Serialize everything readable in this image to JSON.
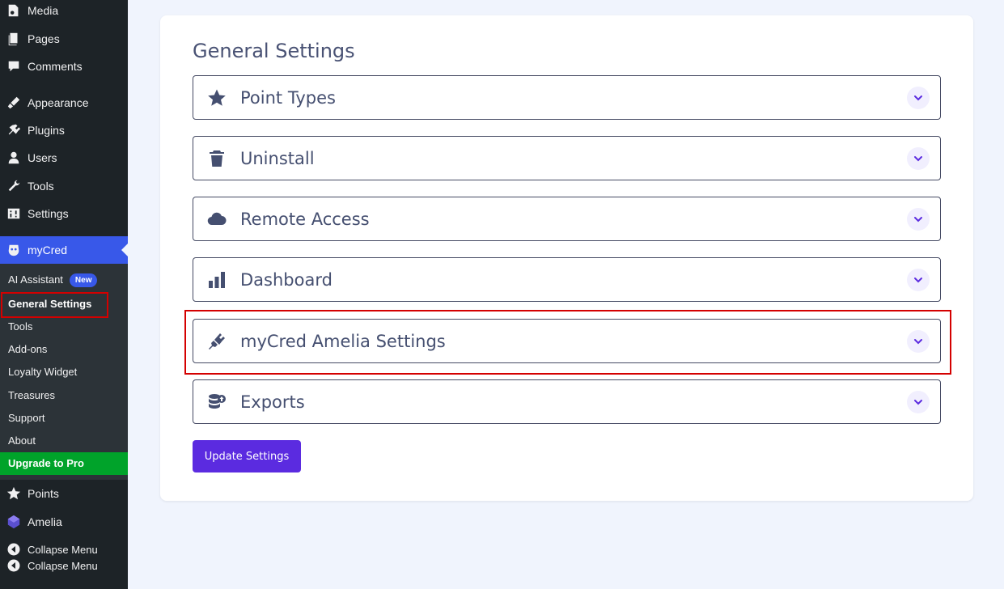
{
  "sidebar": {
    "menu": [
      {
        "label": "Media",
        "icon": "media-icon"
      },
      {
        "label": "Pages",
        "icon": "pages-icon"
      },
      {
        "label": "Comments",
        "icon": "comments-icon"
      },
      {
        "label": "Appearance",
        "icon": "appearance-icon"
      },
      {
        "label": "Plugins",
        "icon": "plugins-icon"
      },
      {
        "label": "Users",
        "icon": "users-icon"
      },
      {
        "label": "Tools",
        "icon": "tools-icon"
      },
      {
        "label": "Settings",
        "icon": "settings-icon"
      },
      {
        "label": "myCred",
        "icon": "mycred-icon"
      }
    ],
    "submenu": [
      {
        "label": "AI Assistant",
        "badge": "New"
      },
      {
        "label": "General Settings"
      },
      {
        "label": "Tools"
      },
      {
        "label": "Add-ons"
      },
      {
        "label": "Loyalty Widget"
      },
      {
        "label": "Treasures"
      },
      {
        "label": "Support"
      },
      {
        "label": "About"
      }
    ],
    "upgrade": "Upgrade to Pro",
    "bottom_menu": [
      {
        "label": "Points",
        "icon": "star-icon"
      },
      {
        "label": "Amelia",
        "icon": "amelia-icon"
      }
    ],
    "collapse": [
      "Collapse Menu",
      "Collapse Menu"
    ]
  },
  "main": {
    "title": "General Settings",
    "sections": [
      {
        "label": "Point Types",
        "icon": "star-icon"
      },
      {
        "label": "Uninstall",
        "icon": "trash-icon"
      },
      {
        "label": "Remote Access",
        "icon": "cloud-icon"
      },
      {
        "label": "Dashboard",
        "icon": "bar-chart-icon"
      },
      {
        "label": "myCred Amelia Settings",
        "icon": "plug-icon"
      },
      {
        "label": "Exports",
        "icon": "database-export-icon"
      }
    ],
    "update_button": "Update Settings"
  },
  "colors": {
    "sidebar_bg": "#1d2327",
    "active_blue": "#3858e9",
    "upgrade_green": "#00a32a",
    "button_purple": "#5b2be0",
    "highlight_red": "#d40000"
  }
}
